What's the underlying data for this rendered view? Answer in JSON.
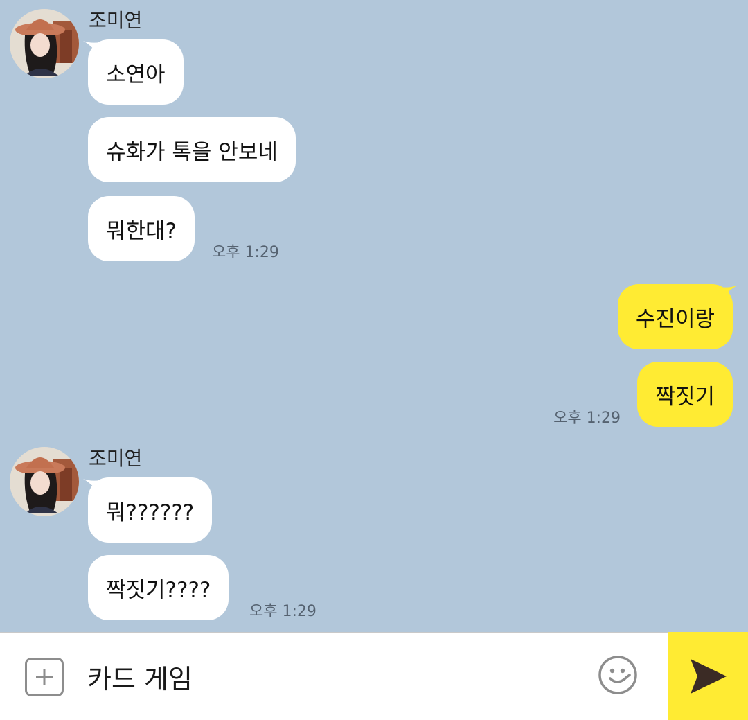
{
  "colors": {
    "background": "#b2c7da",
    "incoming_bubble": "#ffffff",
    "outgoing_bubble": "#ffeb33",
    "send_button": "#ffeb33"
  },
  "groups": [
    {
      "sender": "조미연",
      "messages": [
        "소연아",
        "슈화가 톡을 안보네",
        "뭐한대?"
      ],
      "time": "오후 1:29"
    },
    {
      "sender": "me",
      "messages": [
        "수진이랑",
        "짝짓기"
      ],
      "time": "오후 1:29"
    },
    {
      "sender": "조미연",
      "messages": [
        "뭐??????",
        "짝짓기????"
      ],
      "time": "오후 1:29"
    }
  ],
  "input": {
    "value": "카드 게임",
    "plus_icon": "plus-square-icon",
    "emoji_icon": "smiley-icon",
    "send_icon": "send-arrow-icon"
  }
}
